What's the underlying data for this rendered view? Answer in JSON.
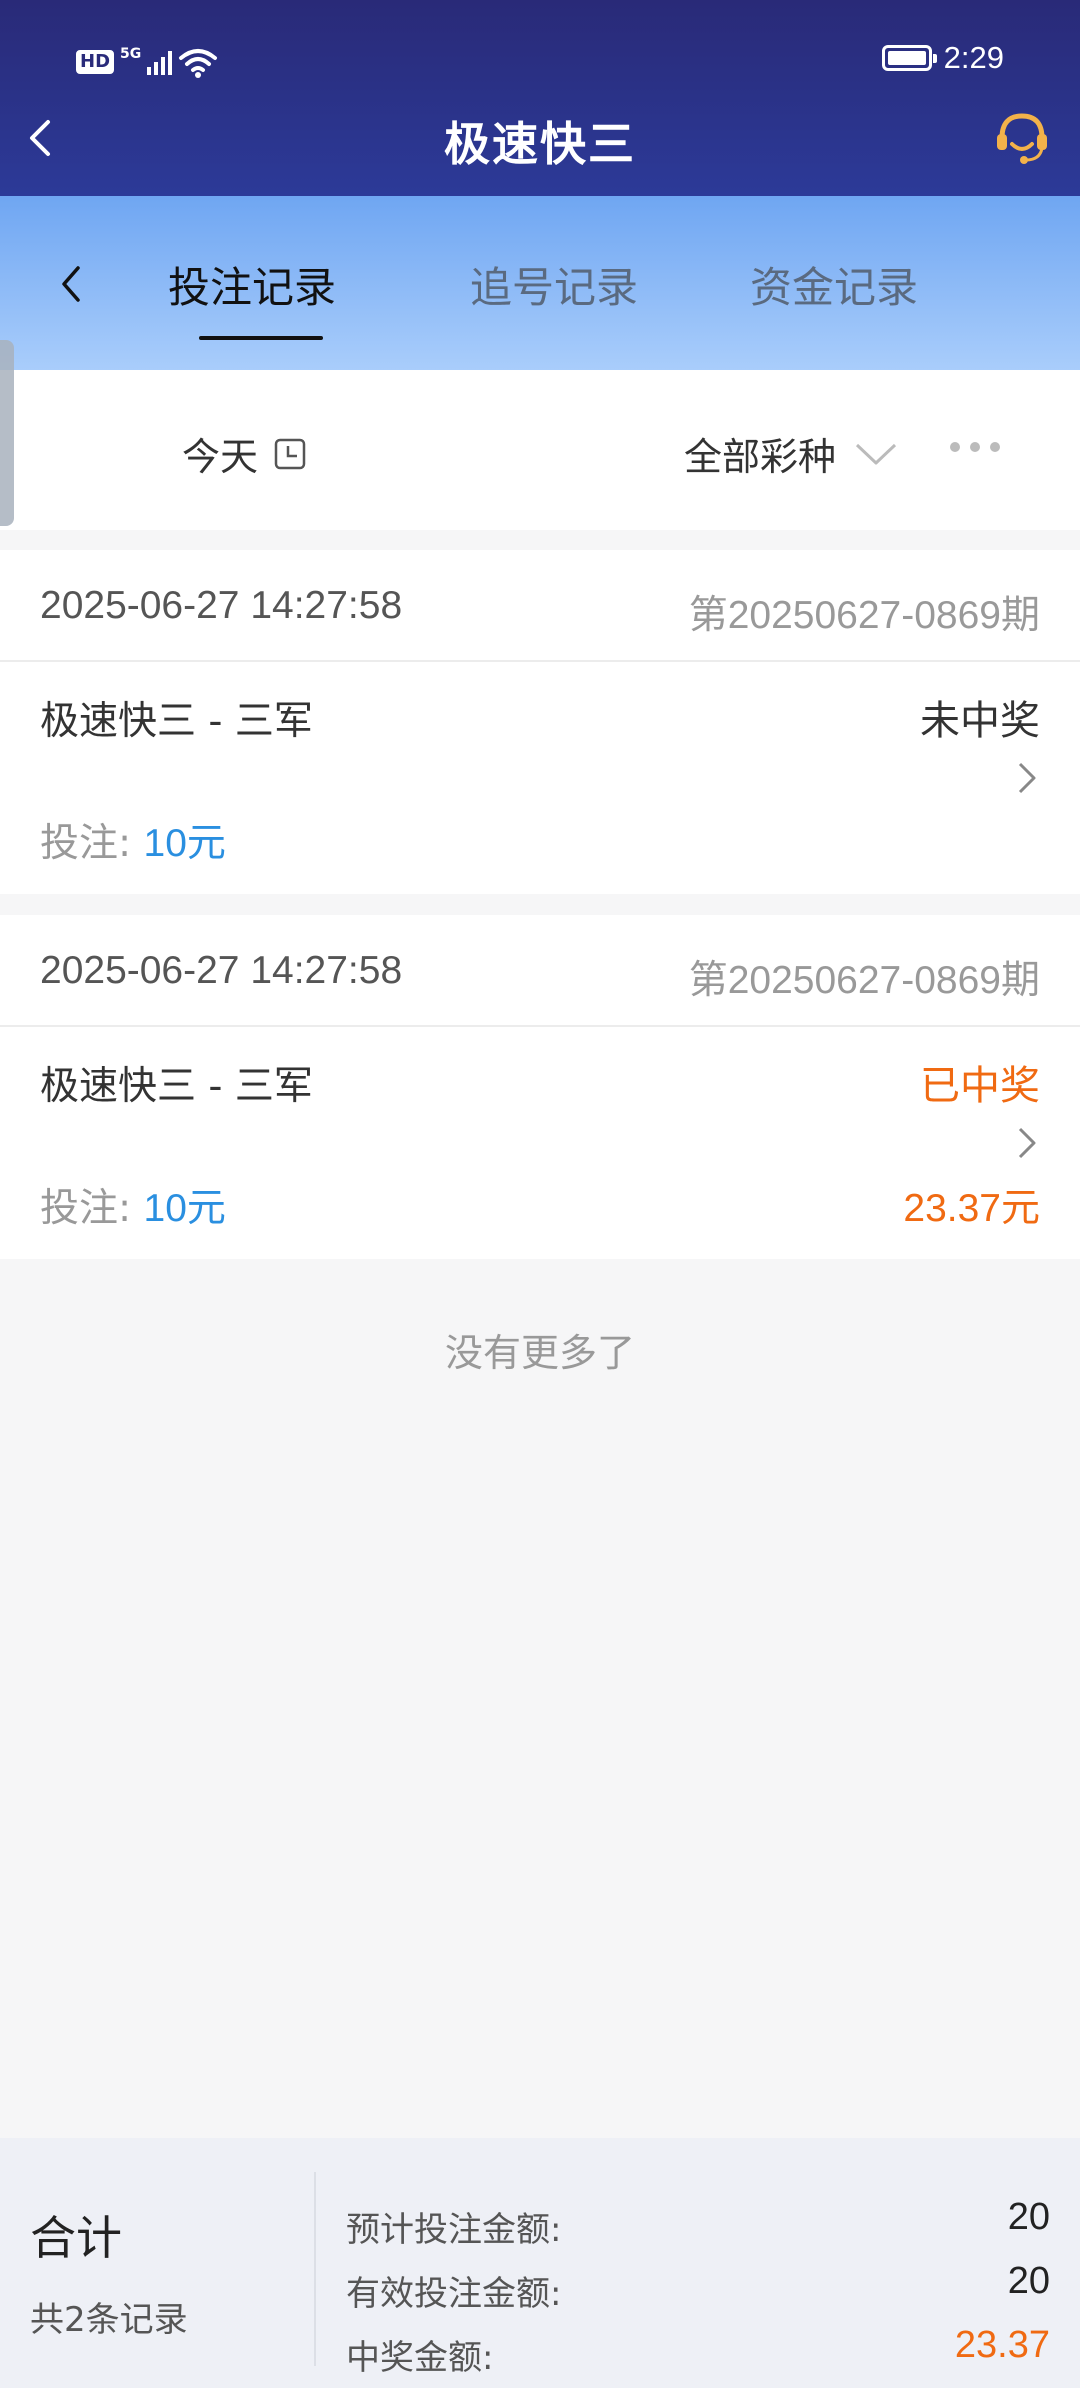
{
  "status_bar": {
    "time": "2:29",
    "hd": "HD",
    "net": "5G",
    "battery_level": 1.0
  },
  "header": {
    "title": "极速快三"
  },
  "tabs": [
    {
      "label": "投注记录",
      "active": true
    },
    {
      "label": "追号记录",
      "active": false
    },
    {
      "label": "资金记录",
      "active": false
    }
  ],
  "filter": {
    "date_label": "今天",
    "type_label": "全部彩种"
  },
  "records": [
    {
      "datetime": "2025-06-27 14:27:58",
      "issue": "第20250627-0869期",
      "game": "极速快三 - 三军",
      "status": "未中奖",
      "bet_label": "投注: ",
      "bet_amount": "10元",
      "prize": ""
    },
    {
      "datetime": "2025-06-27 14:27:58",
      "issue": "第20250627-0869期",
      "game": "极速快三 - 三军",
      "status": "已中奖",
      "bet_label": "投注: ",
      "bet_amount": "10元",
      "prize": "23.37元"
    }
  ],
  "no_more": "没有更多了",
  "summary": {
    "title": "合计",
    "count": "共2条记录",
    "expected_label": "预计投注金额:",
    "expected_value": "20",
    "valid_label": "有效投注金额:",
    "valid_value": "20",
    "prize_label": "中奖金额:",
    "prize_value": "23.37"
  },
  "colors": {
    "header": "#292a78",
    "win": "#f06a12",
    "amount": "#2a8fe0"
  }
}
